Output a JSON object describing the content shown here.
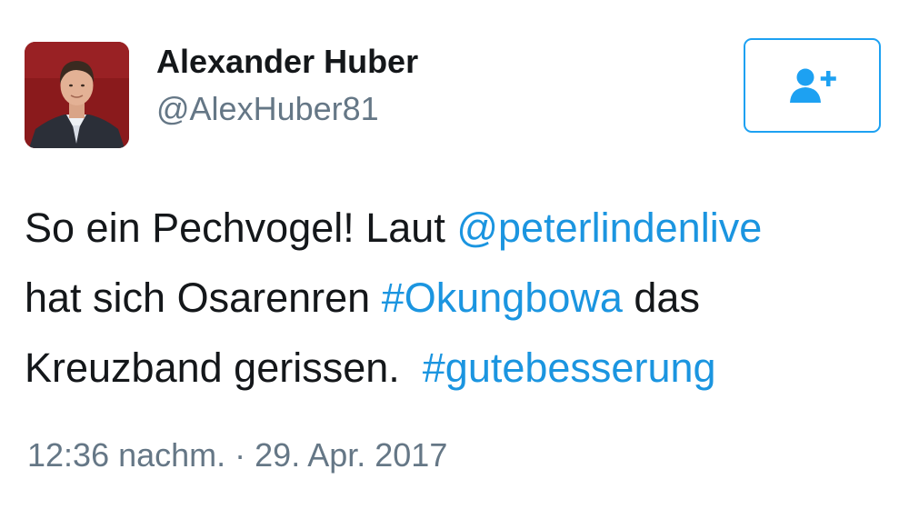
{
  "user": {
    "display_name": "Alexander Huber",
    "handle": "@AlexHuber81"
  },
  "follow_button": {
    "icon": "follow-user-plus-icon",
    "accent_color": "#1da1f2"
  },
  "tweet": {
    "line1_text": "So ein Pechvogel! Laut ",
    "mention": "@peterlindenlive",
    "line2_text": "hat sich Osarenren ",
    "hashtag_1": "#Okungbowa",
    "line2_tail": " das",
    "line3_text": "Kreuzband gerissen.  ",
    "hashtag_2": "#gutebesserung"
  },
  "meta": {
    "time": "12:36 nachm.",
    "separator": " · ",
    "date": "29. Apr. 2017"
  },
  "colors": {
    "text_primary": "#14171a",
    "text_secondary": "#657786",
    "link": "#1b95e0"
  }
}
